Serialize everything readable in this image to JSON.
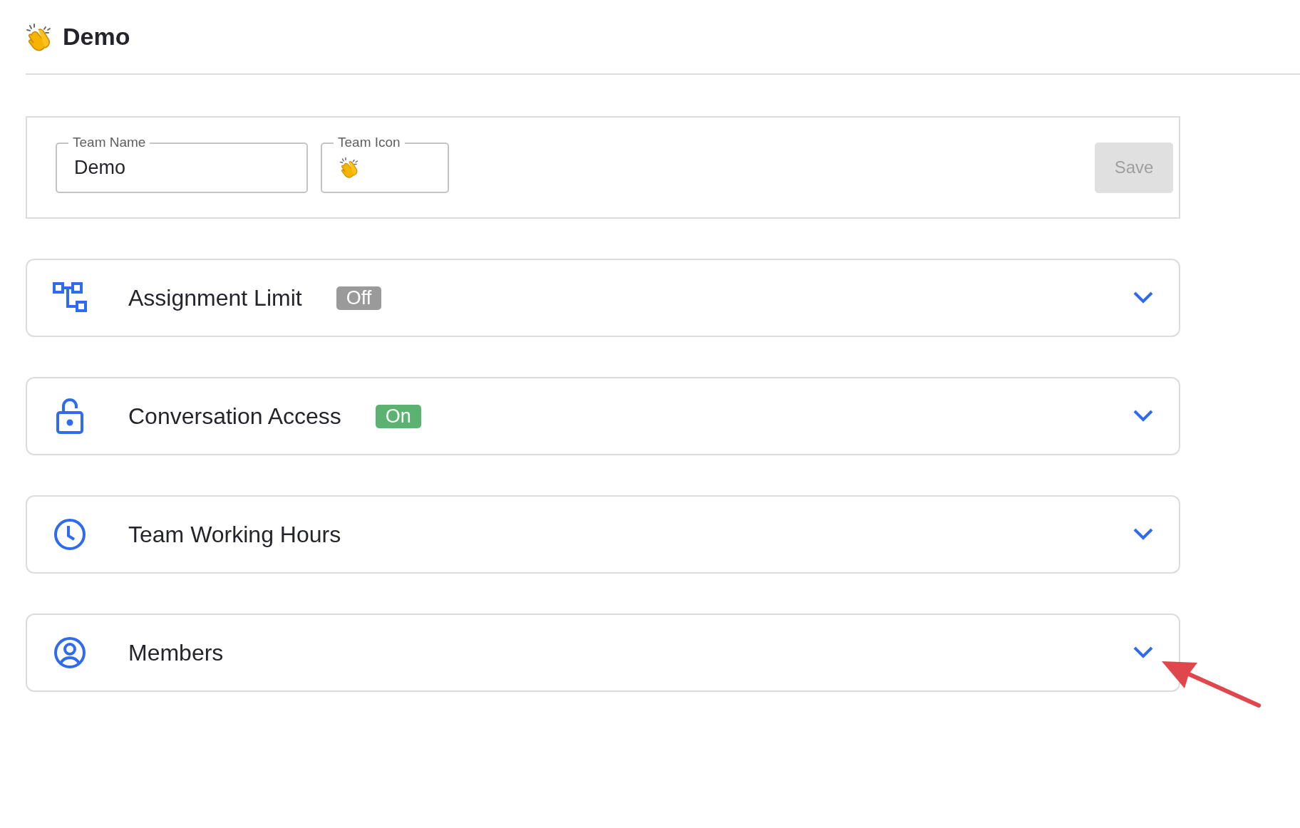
{
  "header": {
    "title": "Demo"
  },
  "team_form": {
    "fields": [
      {
        "kind": "text",
        "label": "Team Name",
        "value": "Demo"
      },
      {
        "kind": "emoji",
        "label": "Team Icon"
      }
    ],
    "save_button": {
      "label": "Save",
      "disabled": true
    }
  },
  "sections": [
    {
      "kind": "hierarchy",
      "title": "Assignment Limit",
      "status": {
        "label": "Off",
        "on": false
      },
      "expanded": false
    },
    {
      "kind": "lock",
      "title": "Conversation Access",
      "status": {
        "label": "On",
        "on": true
      },
      "expanded": false
    },
    {
      "kind": "clock",
      "title": "Team Working Hours",
      "expanded": false
    },
    {
      "kind": "user",
      "title": "Members",
      "expanded": false
    }
  ]
}
